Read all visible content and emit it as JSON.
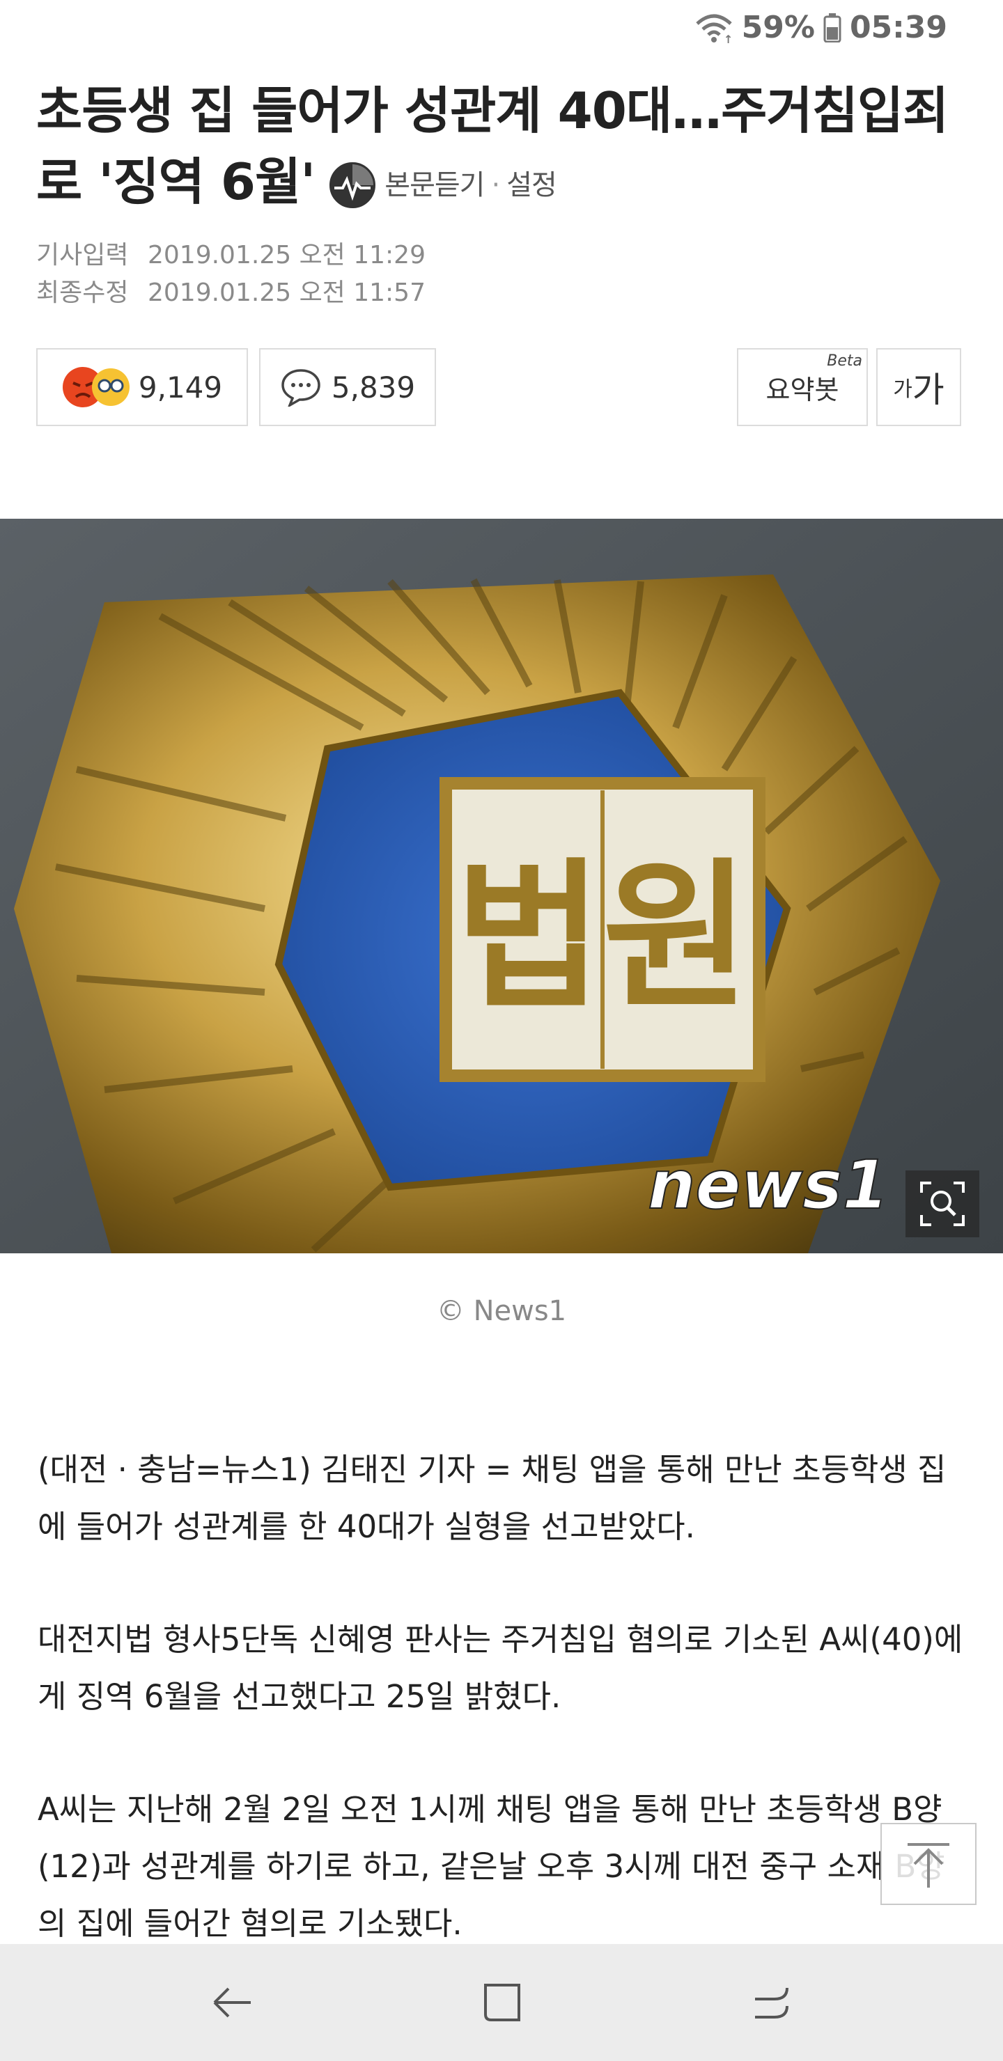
{
  "status_bar": {
    "battery": "59%",
    "time": "05:39",
    "icons": [
      "wifi-icon",
      "battery-icon"
    ]
  },
  "article": {
    "title": "초등생 집 들어가 성관계 40대…주거침입죄로 '징역 6월'",
    "listen_label": "본문듣기",
    "separator": "·",
    "settings_label": "설정",
    "published_label": "기사입력",
    "published": "2019.01.25 오전 11:29",
    "modified_label": "최종수정",
    "modified": "2019.01.25 오전 11:57"
  },
  "actions": {
    "reaction_count": "9,149",
    "comment_count": "5,839",
    "summary_label": "요약봇",
    "summary_badge": "Beta",
    "font_small": "가",
    "font_large": "가"
  },
  "image": {
    "caption": "© News1",
    "watermark": "news1",
    "plaque_text": "법원"
  },
  "body": {
    "paragraphs": [
      "(대전 · 충남=뉴스1) 김태진 기자 = 채팅 앱을 통해 만난 초등학생 집에 들어가 성관계를 한 40대가 실형을 선고받았다.",
      "대전지법 형사5단독 신혜영 판사는 주거침입 혐의로 기소된 A씨(40)에게 징역 6월을 선고했다고 25일 밝혔다.",
      "A씨는 지난해 2월 2일 오전 1시께 채팅 앱을 통해 만난 초등학생 B양(12)과 성관계를 하기로 하고, 같은날 오후 3시께 대전 중구 소재 B양의 집에 들어간 혐의로 기소됐다."
    ]
  },
  "colors": {
    "navbar_bg": "#ececec",
    "court_blue": "#2a5db5",
    "gold": "#c9a245"
  }
}
